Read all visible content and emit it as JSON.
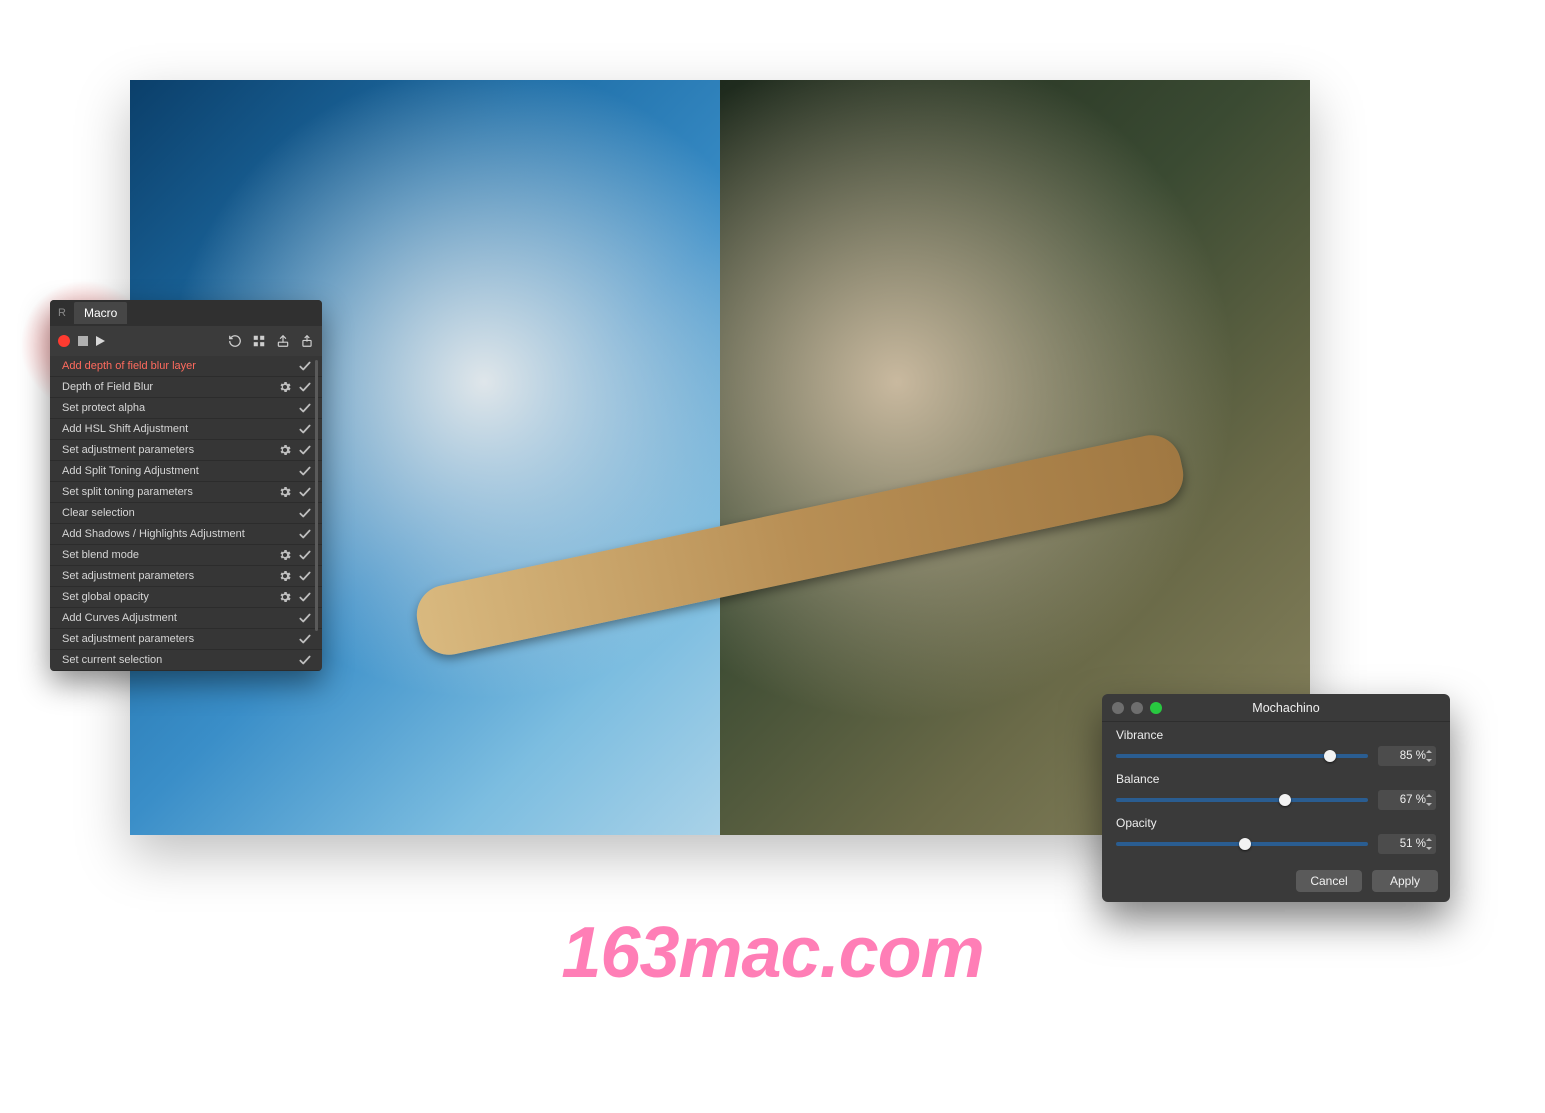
{
  "macro": {
    "dim_tab": "R",
    "tab_title": "Macro",
    "steps": [
      {
        "label": "Add depth of field blur layer",
        "gear": false,
        "highlight": true
      },
      {
        "label": "Depth of Field Blur",
        "gear": true
      },
      {
        "label": "Set protect alpha",
        "gear": false
      },
      {
        "label": "Add HSL Shift Adjustment",
        "gear": false
      },
      {
        "label": "Set adjustment parameters",
        "gear": true
      },
      {
        "label": "Add Split Toning Adjustment",
        "gear": false
      },
      {
        "label": "Set split toning parameters",
        "gear": true
      },
      {
        "label": "Clear selection",
        "gear": false
      },
      {
        "label": "Add Shadows / Highlights Adjustment",
        "gear": false
      },
      {
        "label": "Set blend mode",
        "gear": true
      },
      {
        "label": "Set adjustment parameters",
        "gear": true
      },
      {
        "label": "Set global opacity",
        "gear": true
      },
      {
        "label": "Add Curves Adjustment",
        "gear": false
      },
      {
        "label": "Set adjustment parameters",
        "gear": false
      },
      {
        "label": "Set current selection",
        "gear": false
      }
    ]
  },
  "adjust": {
    "title": "Mochachino",
    "sliders": [
      {
        "label": "Vibrance",
        "percent": 85,
        "display": "85 %"
      },
      {
        "label": "Balance",
        "percent": 67,
        "display": "67 %"
      },
      {
        "label": "Opacity",
        "percent": 51,
        "display": "51 %"
      }
    ],
    "cancel": "Cancel",
    "apply": "Apply"
  },
  "watermark": "163mac.com"
}
